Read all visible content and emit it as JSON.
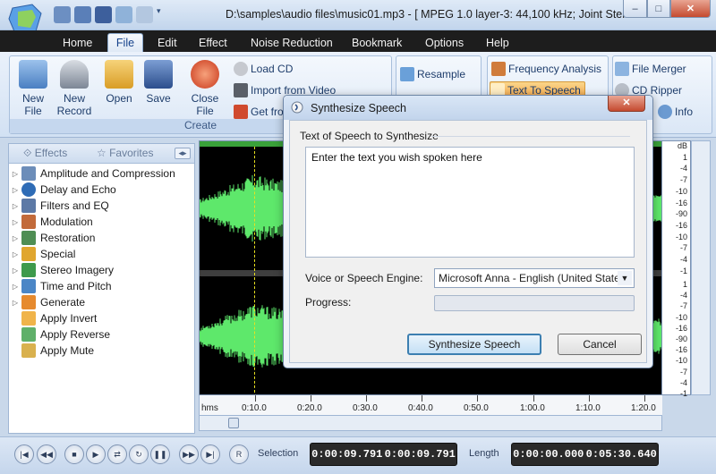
{
  "window": {
    "title": "D:\\samples\\audio files\\music01.mp3 - [ MPEG 1.0 layer-3: 44,100 kHz; Joint Ster...",
    "controls": {
      "minimize": "–",
      "maximize": "□",
      "close": "✕"
    }
  },
  "quick_access": [
    "open-icon",
    "new-icon",
    "save-icon",
    "undo-icon",
    "redo-icon",
    "customize-icon"
  ],
  "ribbon": {
    "tabs": [
      {
        "label": "Home",
        "active": false
      },
      {
        "label": "File",
        "active": true
      },
      {
        "label": "Edit",
        "active": false
      },
      {
        "label": "Effect",
        "active": false
      },
      {
        "label": "Noise Reduction",
        "active": false
      },
      {
        "label": "Bookmark",
        "active": false
      },
      {
        "label": "Options",
        "active": false
      },
      {
        "label": "Help",
        "active": false
      }
    ],
    "create_group": {
      "label": "Create",
      "buttons": [
        {
          "label": "New File",
          "icon": "new-file-icon"
        },
        {
          "label": "New Record",
          "icon": "microphone-icon"
        },
        {
          "label": "Open",
          "icon": "open-folder-icon"
        },
        {
          "label": "Save",
          "icon": "save-disk-icon"
        },
        {
          "label": "Close File",
          "icon": "power-icon"
        }
      ],
      "small_buttons": [
        {
          "label": "Load CD",
          "icon": "cd-icon"
        },
        {
          "label": "Import from Video",
          "icon": "film-icon"
        },
        {
          "label": "Get fro",
          "icon": "web-icon"
        }
      ]
    },
    "tools_group": {
      "buttons": [
        {
          "label": "Resample",
          "icon": "resample-icon",
          "highlight": false
        },
        {
          "label": "Frequency Analysis",
          "icon": "spectrum-icon",
          "highlight": false
        },
        {
          "label": "Text To Speech",
          "icon": "speech-icon",
          "highlight": true
        },
        {
          "label": "File Merger",
          "icon": "merge-icon",
          "highlight": false
        },
        {
          "label": "CD Ripper",
          "icon": "cd-ripper-icon",
          "highlight": false
        },
        {
          "label": "Info",
          "icon": "info-icon",
          "highlight": false
        }
      ]
    }
  },
  "left_panel": {
    "tabs": [
      "Effects",
      "Favorites"
    ],
    "items": [
      {
        "label": "Amplitude and Compression",
        "expandable": true,
        "icon": "amplitude-icon"
      },
      {
        "label": "Delay and Echo",
        "expandable": true,
        "icon": "echo-icon"
      },
      {
        "label": "Filters and EQ",
        "expandable": true,
        "icon": "equalizer-icon"
      },
      {
        "label": "Modulation",
        "expandable": true,
        "icon": "modulation-icon"
      },
      {
        "label": "Restoration",
        "expandable": true,
        "icon": "restoration-icon"
      },
      {
        "label": "Special",
        "expandable": true,
        "icon": "special-icon"
      },
      {
        "label": "Stereo Imagery",
        "expandable": true,
        "icon": "stereo-icon"
      },
      {
        "label": "Time and Pitch",
        "expandable": true,
        "icon": "pitch-icon"
      },
      {
        "label": "Generate",
        "expandable": true,
        "icon": "generate-icon"
      },
      {
        "label": "Apply Invert",
        "expandable": false,
        "icon": "invert-icon"
      },
      {
        "label": "Apply Reverse",
        "expandable": false,
        "icon": "reverse-icon"
      },
      {
        "label": "Apply Mute",
        "expandable": false,
        "icon": "mute-icon"
      }
    ]
  },
  "waveform": {
    "color": "#5ee86b",
    "db_scale_top": [
      "dB",
      "1",
      "-4",
      "-7",
      "-10",
      "-16",
      "-90",
      "-16",
      "-10",
      "-7",
      "-4",
      "-1"
    ],
    "db_scale_bottom": [
      "1",
      "-4",
      "-7",
      "-10",
      "-16",
      "-90",
      "-16",
      "-10",
      "-7",
      "-4",
      "-1"
    ]
  },
  "ruler": {
    "unit": "hms",
    "labels": [
      "0:10.0",
      "0:20.0",
      "0:30.0",
      "0:40.0",
      "0:50.0",
      "1:00.0",
      "1:10.0",
      "1:20.0"
    ]
  },
  "transport": {
    "buttons": [
      "skip-start-icon",
      "rewind-icon",
      "stop-icon",
      "play-icon",
      "loop-icon",
      "pause-icon",
      "fast-forward-icon",
      "skip-end-icon",
      "record-icon"
    ],
    "selection_label": "Selection",
    "selection_start": "0:00:09.791",
    "selection_end": "0:00:09.791",
    "length_label": "Length",
    "length_start": "0:00:00.000",
    "length_end": "0:05:30.640"
  },
  "dialog": {
    "title": "Synthesize Speech",
    "close": "✕",
    "text_section_label": "Text of Speech to Synthesize",
    "text_value": "Enter the text you wish spoken here",
    "voice_label": "Voice or Speech Engine:",
    "voice_value": "Microsoft Anna - English (United States",
    "progress_label": "Progress:",
    "progress_value": 0,
    "synthesize_button": "Synthesize Speech",
    "cancel_button": "Cancel"
  }
}
